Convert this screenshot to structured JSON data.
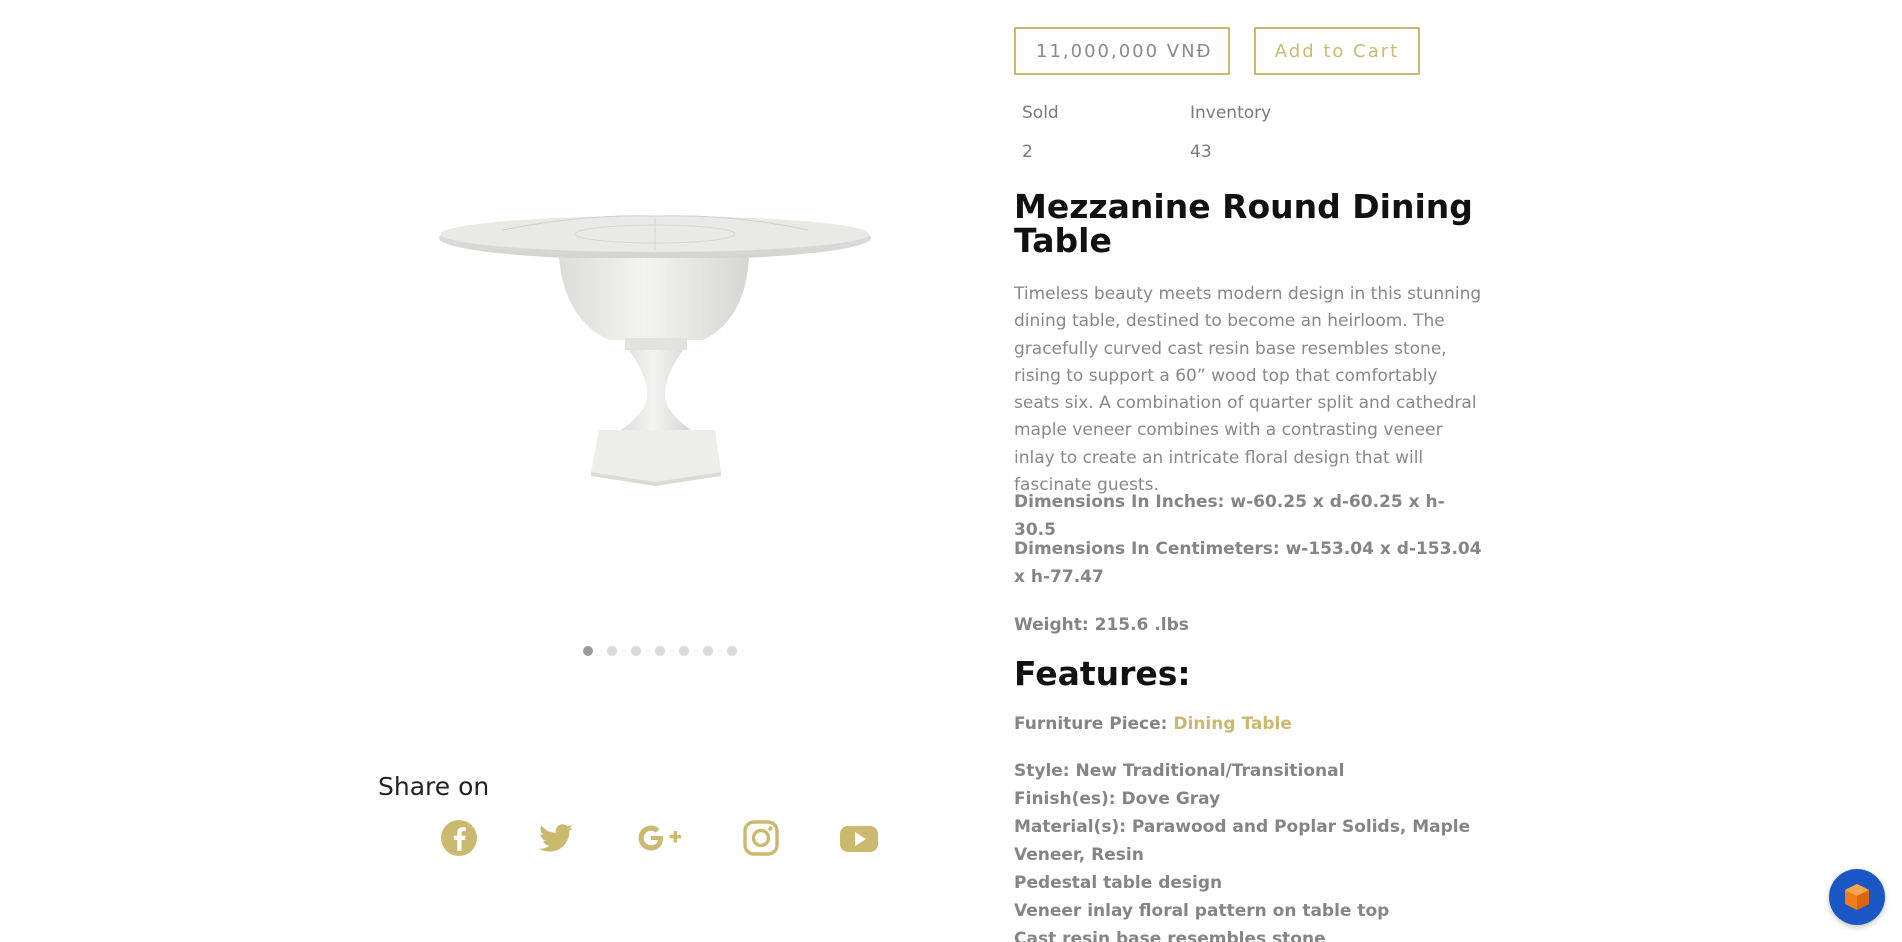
{
  "gallery": {
    "image_alt": "Mezzanine Round Dining Table",
    "slide_count": 7,
    "active_slide": 1
  },
  "share": {
    "title": "Share on",
    "icons": [
      "facebook-icon",
      "twitter-icon",
      "google-plus-icon",
      "instagram-icon",
      "youtube-icon"
    ]
  },
  "purchase": {
    "price": "11,000,000 VNĐ",
    "add_to_cart": "Add to Cart"
  },
  "stats": {
    "sold_label": "Sold",
    "sold_value": "2",
    "inventory_label": "Inventory",
    "inventory_value": "43"
  },
  "product": {
    "title": "Mezzanine Round Dining Table",
    "description": "Timeless beauty meets modern design in this stunning dining table, destined to become an heirloom. The gracefully curved cast resin base resembles stone, rising to support a 60” wood top that comfortably seats six. A combination of quarter split and cathedral maple veneer combines with a contrasting veneer inlay to create an intricate floral design that will fascinate guests.",
    "dimensions_inches": "Dimensions In Inches: w-60.25 x d-60.25 x h-30.5",
    "dimensions_cm": "Dimensions In Centimeters: w-153.04 x d-153.04 x h-77.47",
    "weight": "Weight: 215.6 .lbs"
  },
  "features": {
    "title": "Features:",
    "furniture_piece_label": "Furniture Piece: ",
    "furniture_piece_link": "Dining Table",
    "style": "Style: New Traditional/Transitional",
    "finish": "Finish(es): Dove Gray",
    "materials": "Material(s): Parawood and Poplar Solids, Maple Veneer, Resin",
    "pedestal": "Pedestal table design",
    "veneer": "Veneer inlay floral pattern on table top",
    "cast_resin": "Cast resin base resembles stone"
  },
  "colors": {
    "accent_gold": "#cbb96f",
    "chat_blue": "#1a56c4",
    "chat_orange": "#f07d1a"
  }
}
